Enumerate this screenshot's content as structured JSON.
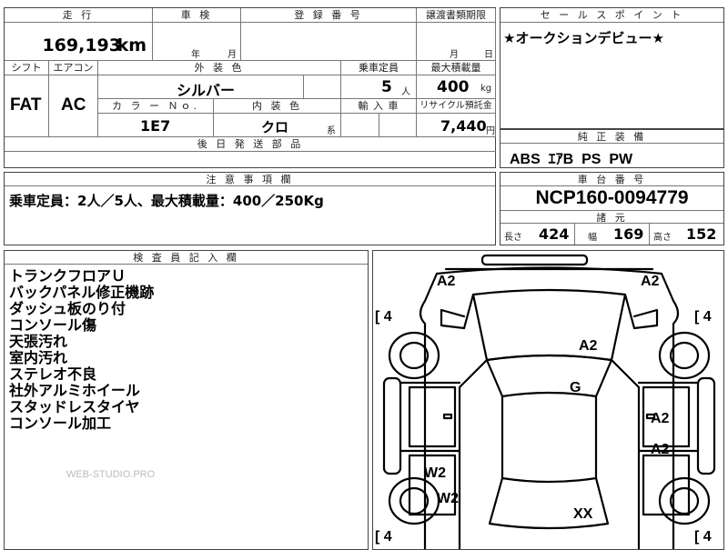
{
  "top": {
    "mileage_label": "走 行",
    "mileage_value": "169,193",
    "mileage_unit": "km",
    "inspection_label": "車 検",
    "inspection_year": "年",
    "inspection_month": "月",
    "reg_label": "登 録 番 号",
    "transfer_label": "譲渡書類期限",
    "transfer_month": "月",
    "transfer_day": "日"
  },
  "mid": {
    "shift_label": "シフト",
    "aircon_label": "エアコン",
    "exterior_label": "外 装 色",
    "capacity_label": "乗車定員",
    "maxload_label": "最大積載量",
    "shift_value": "FAT",
    "aircon_value": "AC",
    "exterior_value": "シルバー",
    "capacity_value": "5",
    "capacity_unit": "人",
    "maxload_value": "400",
    "maxload_unit": "kg",
    "colorno_label": "カ ラ ー Ｎｏ.",
    "interior_label": "内 装 色",
    "import_label": "輸 入 車",
    "recycle_label": "リサイクル預託金",
    "colorno_value": "1E7",
    "interior_value": "クロ",
    "interior_suffix": "系",
    "recycle_value": "7,440",
    "recycle_unit": "円",
    "later_label": "後 日 発 送 部 品"
  },
  "sales": {
    "label": "セ ー ル ス ポ イ ン ト",
    "text": "★オークションデビュー★"
  },
  "equipment": {
    "label": "純 正 装 備",
    "text": "ABS  ｴｱB  PS  PW"
  },
  "notes": {
    "label": "注 意 事 項 欄",
    "text": "乗車定員：2人／5人、最大積載量：400／250Kg"
  },
  "chassis": {
    "label": "車 台 番 号",
    "value": "NCP160-0094779",
    "spec_label": "諸 元",
    "length_label": "長さ",
    "length_value": "424",
    "width_label": "幅",
    "width_value": "169",
    "height_label": "高さ",
    "height_value": "152"
  },
  "inspector": {
    "label": "検 査 員 記 入 欄",
    "lines": [
      "トランクフロアＵ",
      "バックパネル修正機跡",
      "ダッシュ板のり付",
      "コンソール傷",
      "天張汚れ",
      "室内汚れ",
      "ステレオ不良",
      "社外アルミホイール",
      "スタッドレスタイヤ",
      "コンソール加工"
    ],
    "watermark": "WEB-STUDIO.PRO"
  },
  "diagram": {
    "marks": [
      "A2",
      "A2",
      "A2",
      "G",
      "A2",
      "A2",
      "W2",
      "W2",
      "XX"
    ],
    "tires": [
      "[ 4",
      "[ 4",
      "[ 4",
      "[ 4"
    ]
  }
}
